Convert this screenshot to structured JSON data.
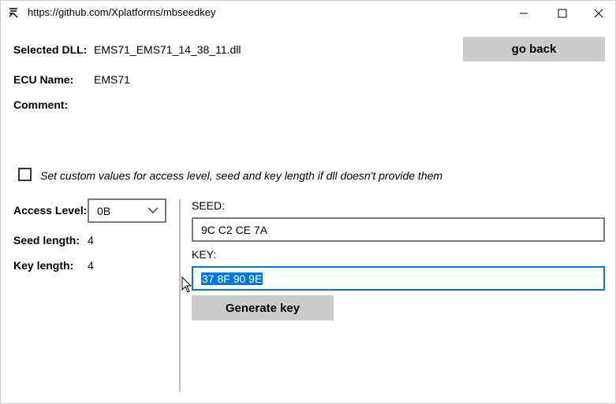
{
  "window": {
    "title": "https://github.com/Xplatforms/mbseedkey",
    "icons": {
      "app": "app-logo-icon",
      "minimize": "minimize-icon",
      "maximize": "maximize-icon",
      "close": "close-icon"
    }
  },
  "info": {
    "selected_dll_label": "Selected DLL:",
    "selected_dll_value": "EMS71_EMS71_14_38_11.dll",
    "ecu_name_label": "ECU Name:",
    "ecu_name_value": "EMS71",
    "comment_label": "Comment:",
    "comment_value": ""
  },
  "go_back_label": "go back",
  "custom_values": {
    "checked": false,
    "label": "Set custom values for access level, seed and key length if dll doesn't provide them"
  },
  "params": {
    "access_level_label": "Access Level:",
    "access_level_value": "0B",
    "seed_length_label": "Seed length:",
    "seed_length_value": "4",
    "key_length_label": "Key length:",
    "key_length_value": "4"
  },
  "seed": {
    "label": "SEED:",
    "value": "9C C2 CE 7A"
  },
  "key": {
    "label": "KEY:",
    "value": "37 8F 90 9E"
  },
  "generate_label": "Generate key",
  "colors": {
    "accent": "#0078d7",
    "button_bg": "#cccccc",
    "divider": "#b9b9b9"
  }
}
